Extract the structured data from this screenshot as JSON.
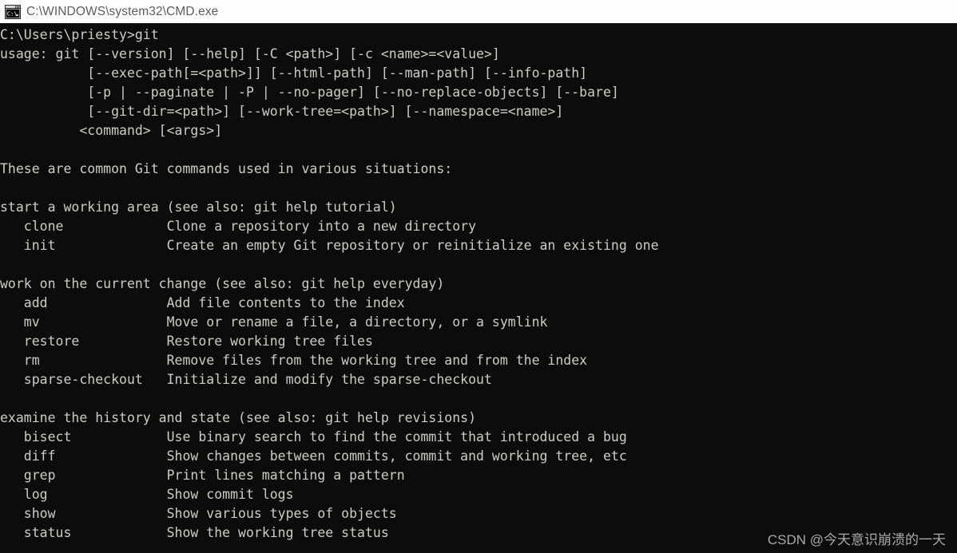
{
  "titlebar": {
    "icon": "cmd-console-icon",
    "title": "C:\\WINDOWS\\system32\\CMD.exe"
  },
  "terminal": {
    "background_color": "#0c0c0c",
    "text_color": "#ccccc7",
    "prompt_line": "C:\\Users\\priesty>git",
    "lines": [
      "C:\\Users\\priesty>git",
      "usage: git [--version] [--help] [-C <path>] [-c <name>=<value>]",
      "           [--exec-path[=<path>]] [--html-path] [--man-path] [--info-path]",
      "           [-p | --paginate | -P | --no-pager] [--no-replace-objects] [--bare]",
      "           [--git-dir=<path>] [--work-tree=<path>] [--namespace=<name>]",
      "          <command> [<args>]",
      "",
      "These are common Git commands used in various situations:",
      "",
      "start a working area (see also: git help tutorial)",
      "   clone             Clone a repository into a new directory",
      "   init              Create an empty Git repository or reinitialize an existing one",
      "",
      "work on the current change (see also: git help everyday)",
      "   add               Add file contents to the index",
      "   mv                Move or rename a file, a directory, or a symlink",
      "   restore           Restore working tree files",
      "   rm                Remove files from the working tree and from the index",
      "   sparse-checkout   Initialize and modify the sparse-checkout",
      "",
      "examine the history and state (see also: git help revisions)",
      "   bisect            Use binary search to find the commit that introduced a bug",
      "   diff              Show changes between commits, commit and working tree, etc",
      "   grep              Print lines matching a pattern",
      "   log               Show commit logs",
      "   show              Show various types of objects",
      "   status            Show the working tree status"
    ],
    "sections": [
      {
        "heading": "start a working area (see also: git help tutorial)",
        "commands": [
          {
            "name": "clone",
            "description": "Clone a repository into a new directory"
          },
          {
            "name": "init",
            "description": "Create an empty Git repository or reinitialize an existing one"
          }
        ]
      },
      {
        "heading": "work on the current change (see also: git help everyday)",
        "commands": [
          {
            "name": "add",
            "description": "Add file contents to the index"
          },
          {
            "name": "mv",
            "description": "Move or rename a file, a directory, or a symlink"
          },
          {
            "name": "restore",
            "description": "Restore working tree files"
          },
          {
            "name": "rm",
            "description": "Remove files from the working tree and from the index"
          },
          {
            "name": "sparse-checkout",
            "description": "Initialize and modify the sparse-checkout"
          }
        ]
      },
      {
        "heading": "examine the history and state (see also: git help revisions)",
        "commands": [
          {
            "name": "bisect",
            "description": "Use binary search to find the commit that introduced a bug"
          },
          {
            "name": "diff",
            "description": "Show changes between commits, commit and working tree, etc"
          },
          {
            "name": "grep",
            "description": "Print lines matching a pattern"
          },
          {
            "name": "log",
            "description": "Show commit logs"
          },
          {
            "name": "show",
            "description": "Show various types of objects"
          },
          {
            "name": "status",
            "description": "Show the working tree status"
          }
        ]
      }
    ],
    "intro_text": "These are common Git commands used in various situations:"
  },
  "watermark": {
    "text": "CSDN @今天意识崩溃的一天"
  }
}
